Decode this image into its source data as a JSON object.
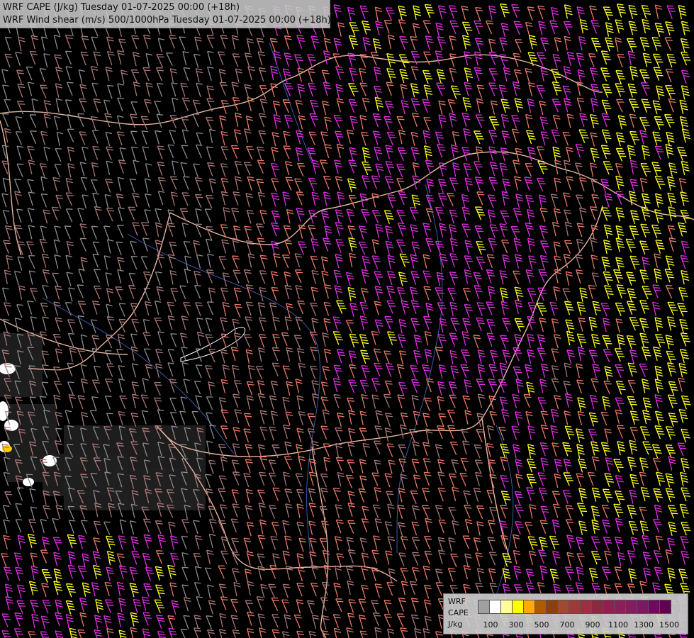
{
  "title": {
    "line1": "WRF CAPE (J/kg) Tuesday 01-07-2025 00:00 (+18h)",
    "line2": "WRF Wind shear (m/s) 500/1000hPa Tuesday 01-07-2025 00:00 (+18h)"
  },
  "legend": {
    "line1": "WRF",
    "line2": "CAPE",
    "unit": "J/kg",
    "ticks": [
      "100",
      "300",
      "500",
      "700",
      "900",
      "1100",
      "1300",
      "1500"
    ],
    "colors": [
      "#a0a0a0",
      "#ffffff",
      "#ffff99",
      "#ffff00",
      "#ffaa00",
      "#b05a00",
      "#8a4010",
      "#a04a30",
      "#a03a3a",
      "#9a3040",
      "#8a2a40",
      "#902050",
      "#88205a",
      "#801e60",
      "#7a1a64",
      "#700a60",
      "#600050"
    ]
  },
  "map": {
    "background_color": "#000000",
    "border_color": "#e8b8a0",
    "river_color": "#3a5aa8",
    "barb_colors": {
      "grey": "#8c8c8c",
      "mauve": "#a87878",
      "salmon": "#e87a6a",
      "magenta": "#e030e0",
      "yellow": "#ffff20"
    }
  }
}
